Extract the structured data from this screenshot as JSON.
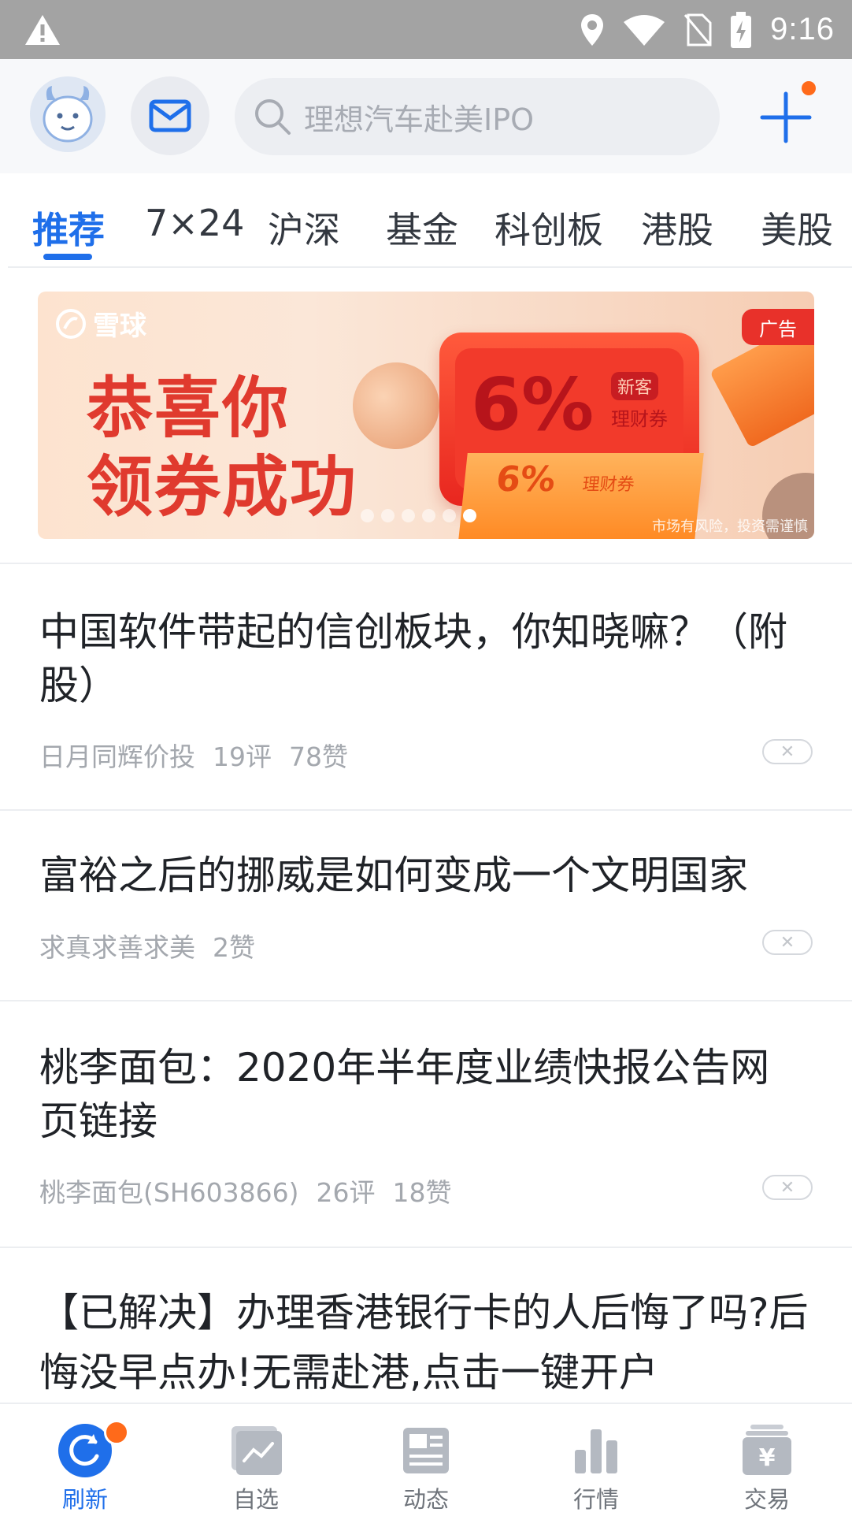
{
  "status_bar": {
    "time": "9:16"
  },
  "header": {
    "search_placeholder": "理想汽车赴美IPO"
  },
  "tabs": [
    {
      "label": "推荐",
      "active": true
    },
    {
      "label": "7×24",
      "active": false
    },
    {
      "label": "沪深",
      "active": false
    },
    {
      "label": "基金",
      "active": false
    },
    {
      "label": "科创板",
      "active": false
    },
    {
      "label": "港股",
      "active": false
    },
    {
      "label": "美股",
      "active": false
    }
  ],
  "banner": {
    "logo": "雪球",
    "ad_badge": "广告",
    "title_line1": "恭喜你",
    "title_line2": "领券成功",
    "card_percent": "6%",
    "card_new": "新客",
    "card_label": "理财券",
    "ticket_percent": "6%",
    "ticket_label": "理财券",
    "disclaimer": "市场有风险，投资需谨慎",
    "dots": 6,
    "active_dot": 5
  },
  "articles": [
    {
      "title": "中国软件带起的信创板块，你知晓嘛？（附股）",
      "author": "日月同辉价投",
      "comments": "19评",
      "likes": "78赞"
    },
    {
      "title": "富裕之后的挪威是如何变成一个文明国家",
      "author": "求真求善求美",
      "comments": "",
      "likes": "2赞"
    },
    {
      "title": "桃李面包：2020年半年度业绩快报公告网页链接",
      "author": "桃李面包(SH603866)",
      "comments": "26评",
      "likes": "18赞"
    },
    {
      "title": "【已解决】办理香港银行卡的人后悔了吗?后悔没早点办!无需赴港,点击一键开户",
      "author": "",
      "comments": "",
      "likes": ""
    }
  ],
  "close_glyph": "✕",
  "bottom_nav": [
    {
      "label": "刷新",
      "icon": "refresh-icon",
      "active": true
    },
    {
      "label": "自选",
      "icon": "watchlist-icon",
      "active": false
    },
    {
      "label": "动态",
      "icon": "feed-icon",
      "active": false
    },
    {
      "label": "行情",
      "icon": "market-icon",
      "active": false
    },
    {
      "label": "交易",
      "icon": "trade-icon",
      "active": false
    }
  ],
  "colors": {
    "accent": "#1f6fea",
    "badge": "#ff6a1a",
    "ad_red": "#e8312a"
  }
}
